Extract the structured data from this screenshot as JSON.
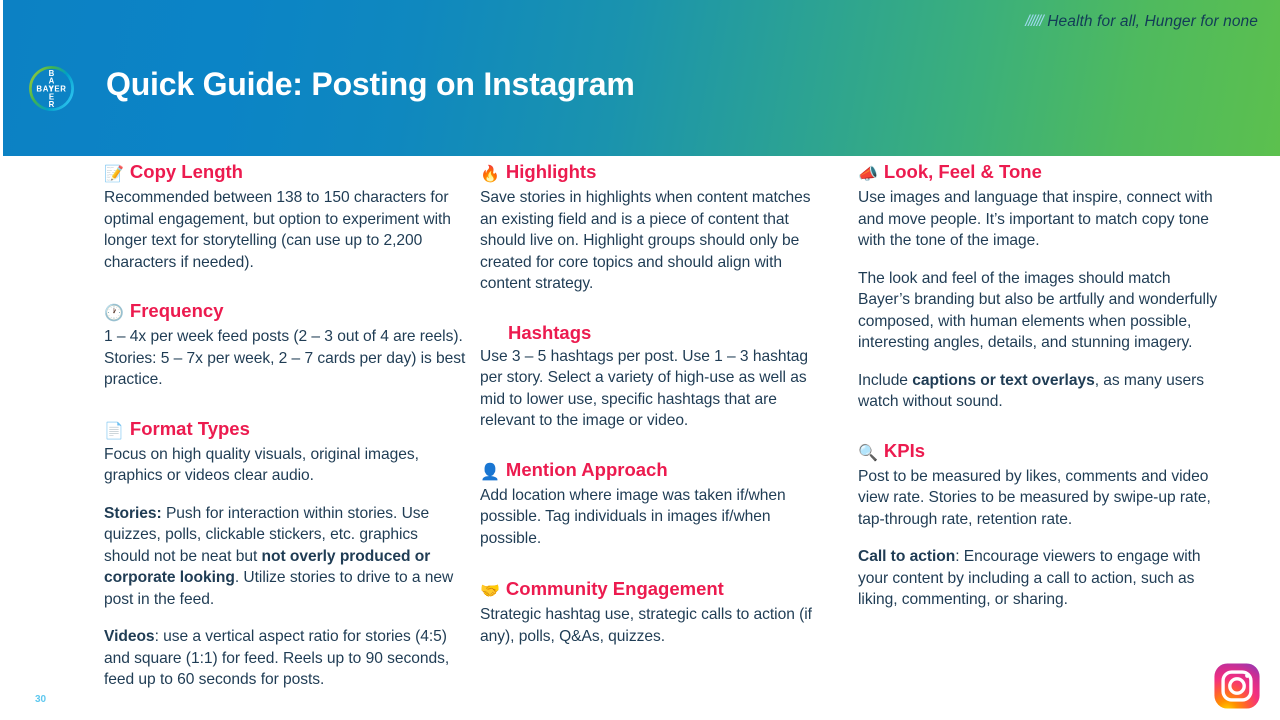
{
  "header": {
    "title": "Quick Guide: Posting on Instagram",
    "tagline": "Health for all, Hunger for none",
    "tagline_slashes": "//////",
    "logo_alt": "BAYER",
    "gradient_from": "#0c81c4",
    "gradient_to": "#5cc04e"
  },
  "theme": {
    "heading_color": "#ec1b4f",
    "body_color": "#1f3c54",
    "page_number_color": "#5ec8ef"
  },
  "columns": [
    {
      "id": "column-1",
      "blocks": [
        {
          "id": "copy-length",
          "icon": "memo-icon",
          "emoji": "📝",
          "heading": "Copy Length",
          "paragraphs": [
            {
              "text": "Recommended between 138 to 150 characters for optimal engagement, but option to experiment with longer text for storytelling (can use up to 2,200 characters if needed)."
            }
          ]
        },
        {
          "id": "frequency",
          "icon": "clock-icon",
          "emoji": "🕐",
          "heading": "Frequency",
          "paragraphs": [
            {
              "text": "1 – 4x per week feed posts (2 – 3 out of 4 are reels). Stories: 5 – 7x per week, 2 – 7 cards per day) is best practice."
            }
          ]
        },
        {
          "id": "format-types",
          "icon": "page-document-icon",
          "emoji": "📄",
          "heading": "Format Types",
          "paragraphs": [
            {
              "text": "Focus on high quality visuals, original images, graphics or videos clear audio."
            },
            {
              "lead": "Stories:",
              "text": " Push for interaction within stories. Use quizzes, polls, clickable stickers, etc. graphics should not be neat but ",
              "bold": "not overly produced or corporate looking",
              "tail": ". Utilize stories to drive to a new post in the feed."
            },
            {
              "lead": "Videos",
              "text": ": use a vertical aspect ratio for stories (4:5) and square (1:1) for feed. Reels up to 90 seconds, feed up to 60 seconds for posts."
            }
          ]
        }
      ]
    },
    {
      "id": "column-2",
      "blocks": [
        {
          "id": "highlights",
          "icon": "fire-icon",
          "emoji": "🔥",
          "heading": "Highlights",
          "paragraphs": [
            {
              "text": "Save stories in highlights when content matches an existing field and is a piece of content that should live on. Highlight groups should only be created for core topics and should align with content strategy."
            }
          ]
        },
        {
          "id": "hashtags",
          "icon": "hashtag-icon",
          "emoji": "",
          "heading": "Hashtags",
          "paragraphs": [
            {
              "text": "Use 3 – 5 hashtags per post. Use 1 – 3 hashtag per story. Select a variety of high-use as well as mid to lower use, specific hashtags that are relevant to the image or video."
            }
          ]
        },
        {
          "id": "mention-approach",
          "icon": "bust-silhouette-icon",
          "emoji": "👤",
          "heading": "Mention Approach",
          "paragraphs": [
            {
              "text": "Add location where image was taken if/when possible. Tag individuals in images if/when possible."
            }
          ]
        },
        {
          "id": "community-engagement",
          "icon": "handshake-icon",
          "emoji": "🤝",
          "heading": "Community Engagement",
          "paragraphs": [
            {
              "text": "Strategic hashtag use, strategic calls to action (if any), polls, Q&As, quizzes."
            }
          ]
        }
      ]
    },
    {
      "id": "column-3",
      "blocks": [
        {
          "id": "look-feel-tone",
          "icon": "megaphone-icon",
          "emoji": "📣",
          "heading": "Look, Feel & Tone",
          "paragraphs": [
            {
              "text": "Use images and language that inspire, connect with and move people. It’s important to match copy tone with the tone of the image."
            },
            {
              "text": "The look and feel of the images should match Bayer’s branding but also be artfully and wonderfully composed, with human elements when possible, interesting angles, details, and stunning imagery."
            },
            {
              "lead": "Include ",
              "bold": "captions or text overlays",
              "tail": ", as many users watch without sound."
            }
          ]
        },
        {
          "id": "kpis",
          "icon": "magnifying-glass-icon",
          "emoji": "🔍",
          "heading": "KPIs",
          "paragraphs": [
            {
              "text": "Post to be measured by likes, comments and video view rate. Stories to be measured by swipe-up rate, tap-through rate, retention rate."
            },
            {
              "bold": "Call to action",
              "tail": ": Encourage viewers to engage with your content by including a call to action, such as liking, commenting, or sharing."
            }
          ]
        }
      ]
    }
  ],
  "footer": {
    "page_number": "30",
    "instagram_logo_alt": "Instagram"
  }
}
